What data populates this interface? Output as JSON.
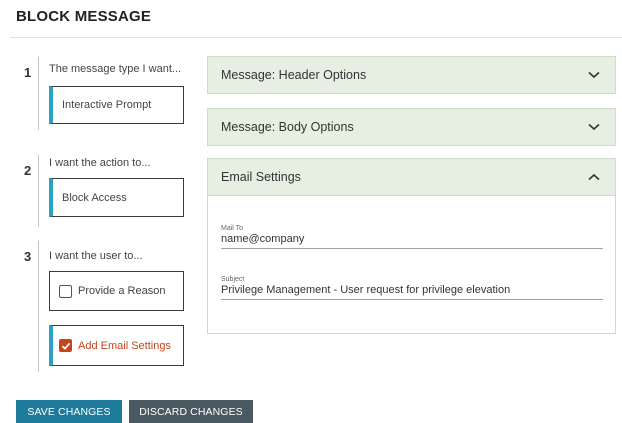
{
  "page": {
    "title": "BLOCK MESSAGE"
  },
  "steps": [
    {
      "number": "1",
      "label": "The message type I want...",
      "option": "Interactive Prompt"
    },
    {
      "number": "2",
      "label": "I want the action to...",
      "option": "Block Access"
    },
    {
      "number": "3",
      "label": "I want the user to...",
      "options": [
        {
          "label": "Provide a Reason",
          "checked": false
        },
        {
          "label": "Add Email Settings",
          "checked": true
        }
      ]
    }
  ],
  "accordions": [
    {
      "label": "Message: Header Options",
      "expanded": false
    },
    {
      "label": "Message: Body Options",
      "expanded": false
    },
    {
      "label": "Email Settings",
      "expanded": true
    }
  ],
  "email_settings": {
    "mail_to": {
      "label": "Mail To",
      "value": "name@company"
    },
    "subject": {
      "label": "Subject",
      "value": "Privilege Management - User request for privilege elevation"
    }
  },
  "buttons": {
    "save": "SAVE CHANGES",
    "discard": "DISCARD CHANGES"
  },
  "colors": {
    "selected_bar": "#2aa3c6",
    "checked_accent": "#c5451f",
    "accordion_bg": "#e6efe2",
    "save_bg": "#1e7a9a",
    "discard_bg": "#4a5862"
  },
  "icons": {
    "collapsed": "chevron-down-icon",
    "expanded": "chevron-up-icon",
    "checked": "checkmark-icon"
  }
}
